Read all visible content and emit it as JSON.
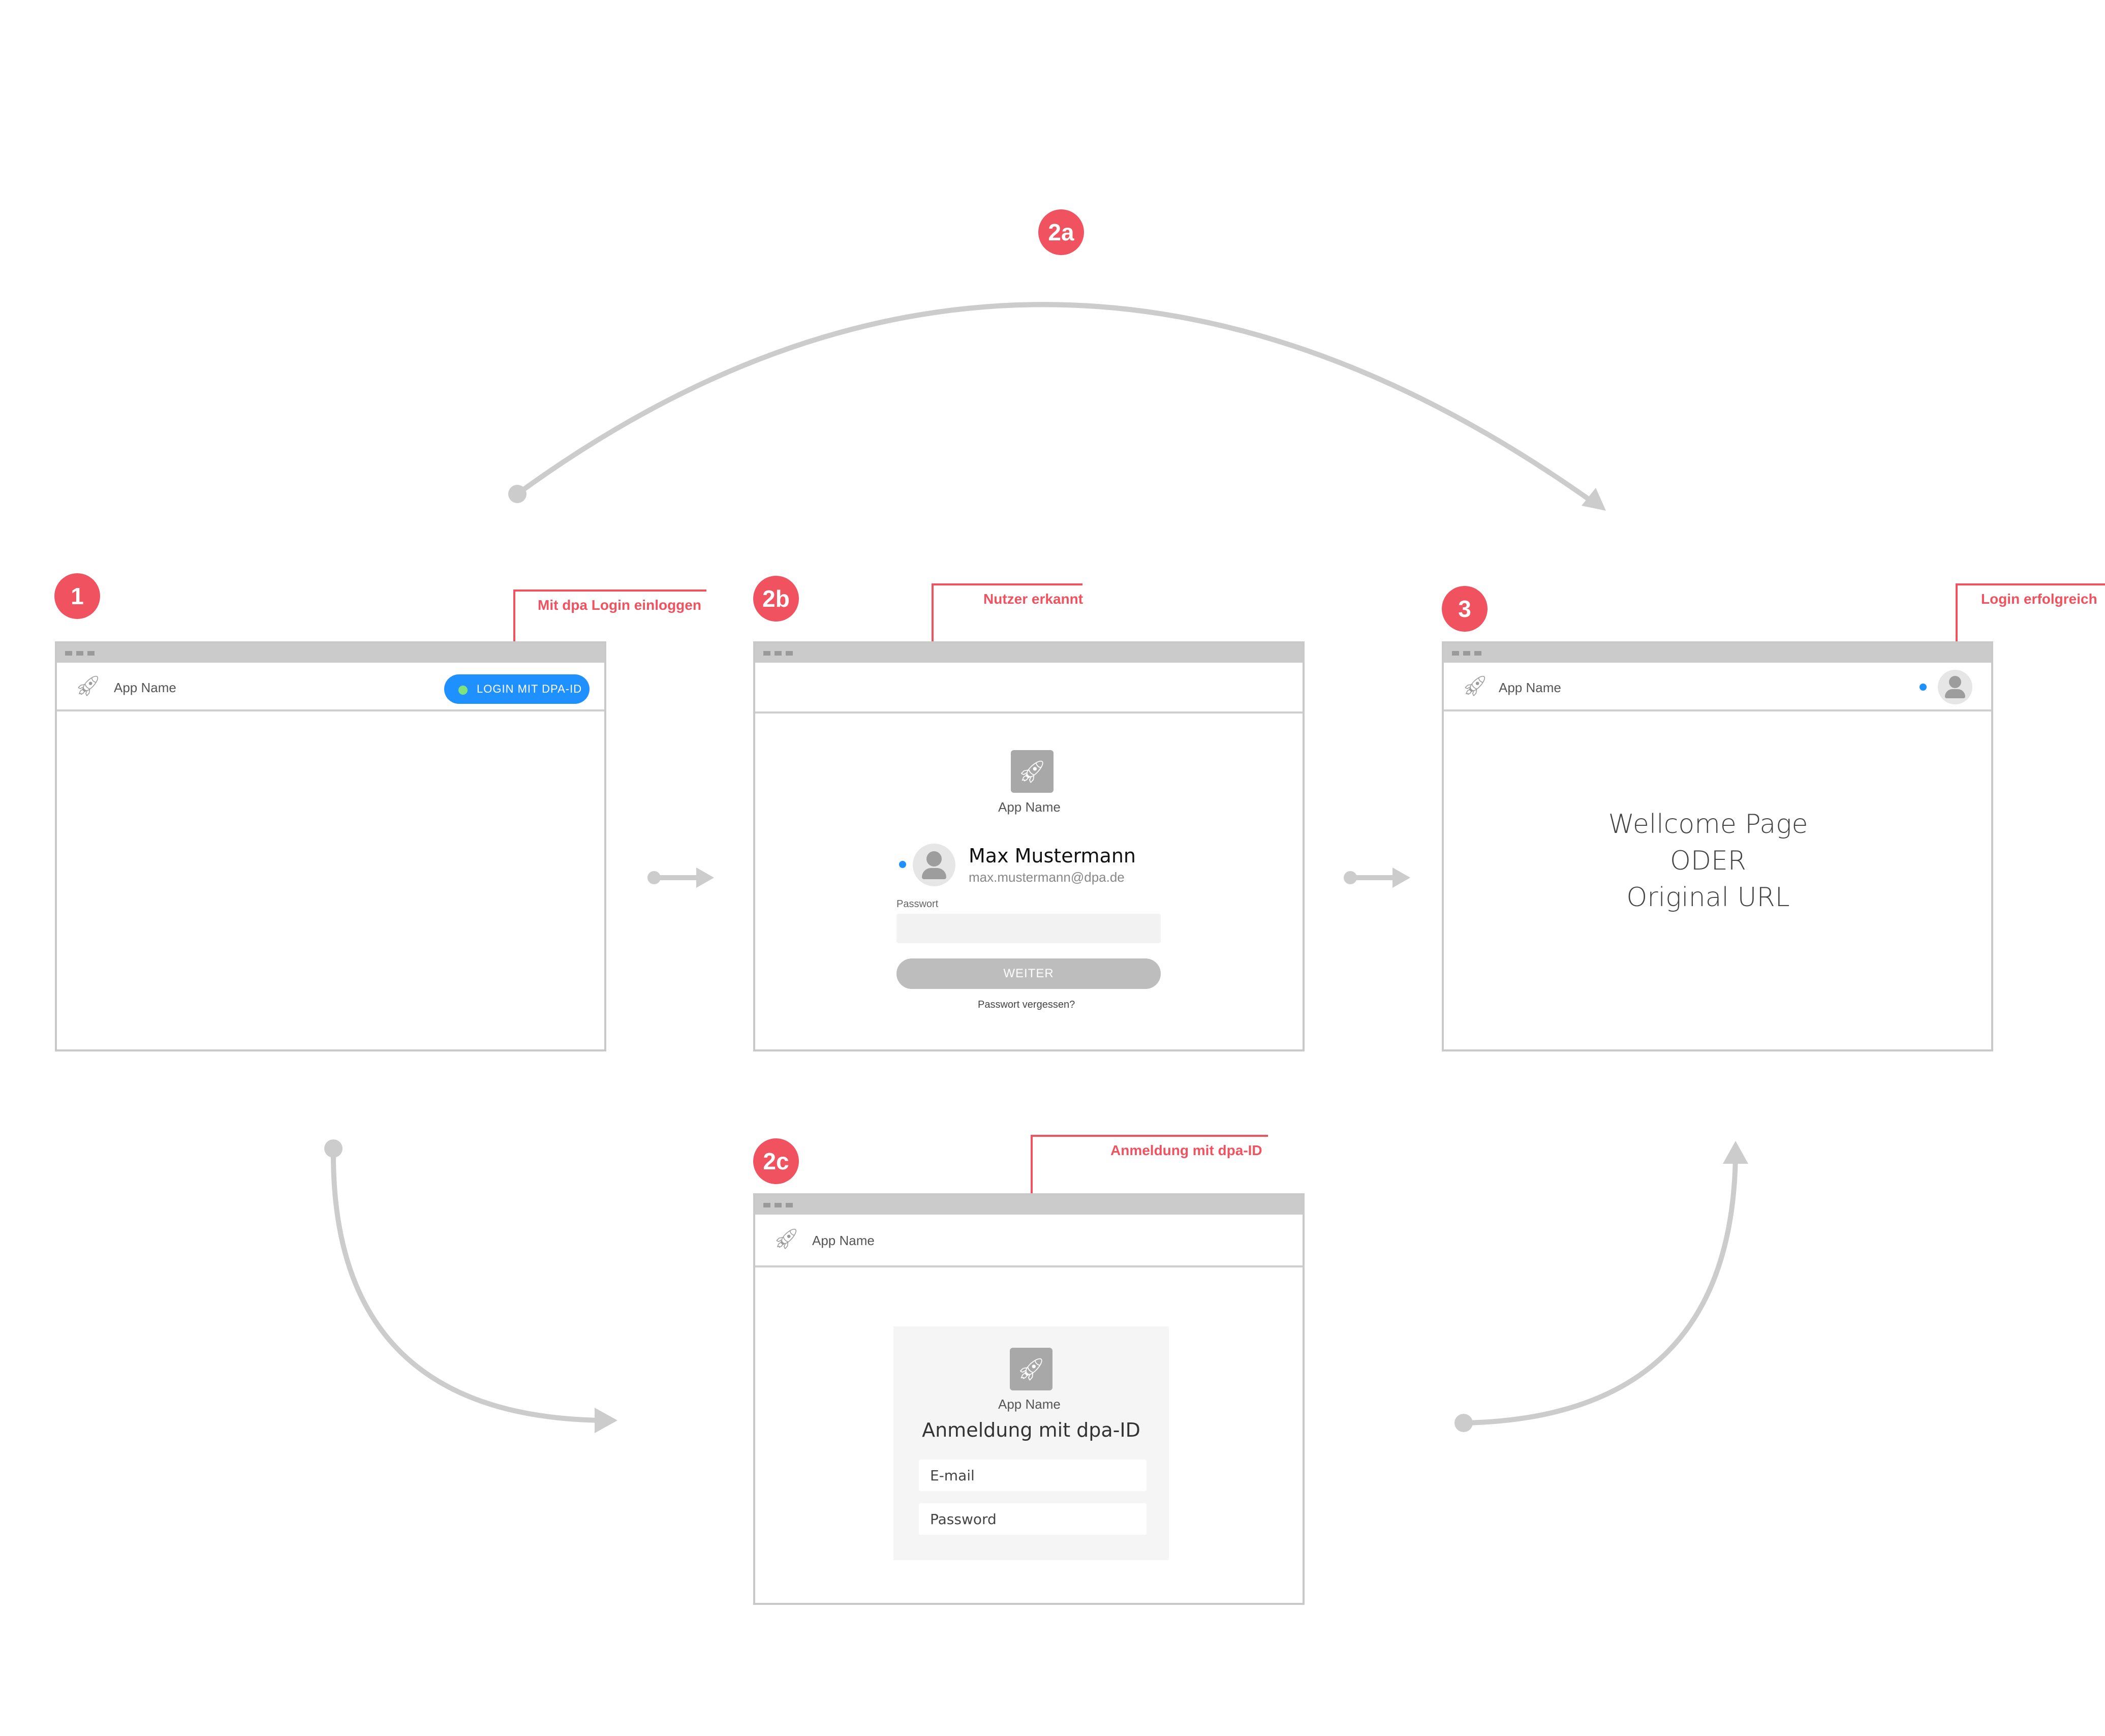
{
  "steps": {
    "s1": "1",
    "s2a": "2a",
    "s2b": "2b",
    "s2c": "2c",
    "s3": "3"
  },
  "callouts": {
    "login_dpa": "Mit dpa Login einloggen",
    "user_recognized": "Nutzer erkannt",
    "login_success": "Login erfolgreich",
    "signin_dpa_id": "Anmeldung mit dpa-ID"
  },
  "window1": {
    "app_name": "App Name",
    "login_button": "LOGIN MIT DPA-ID"
  },
  "window2b": {
    "app_name": "App Name",
    "user_name": "Max Mustermann",
    "user_email": "max.mustermann@dpa.de",
    "password_label": "Passwort",
    "continue_button": "WEITER",
    "forgot_password": "Passwort vergessen?"
  },
  "window3": {
    "app_name": "App Name",
    "content_line1": "Wellcome Page",
    "content_line2": "ODER",
    "content_line3": "Original URL"
  },
  "window2c": {
    "app_name": "App Name",
    "card_app_name": "App Name",
    "heading": "Anmeldung mit dpa-ID",
    "email_placeholder": "E-mail",
    "password_placeholder": "Password"
  },
  "colors": {
    "accent": "#f0525f",
    "primary_button": "#1e90ff",
    "connector": "#cccccc"
  },
  "icons": {
    "app_logo": "rocket-icon",
    "avatar": "user-avatar-icon",
    "window_controls": "dots-icon"
  }
}
